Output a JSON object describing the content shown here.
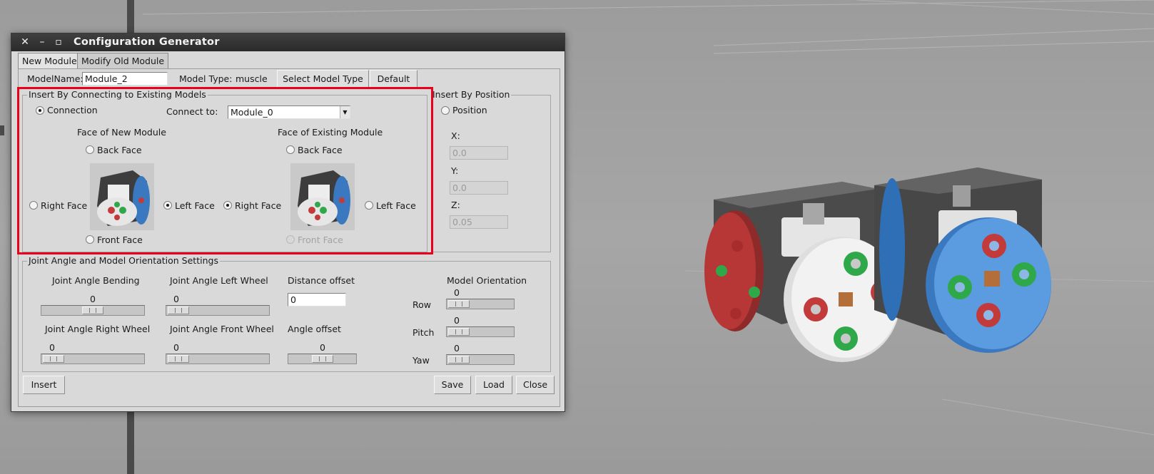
{
  "dialog": {
    "title": "Configuration Generator",
    "window_buttons": {
      "close": "✕",
      "minimize": "–",
      "maximize": "▫"
    },
    "tabs": [
      {
        "label": "New Module",
        "active": true
      },
      {
        "label": "Modify Old Module",
        "active": false
      }
    ],
    "model_name_label": "ModelName:",
    "model_name_value": "Module_2",
    "model_type_label": "Model Type:",
    "model_type_value": "muscle",
    "select_model_type_button": "Select Model Type",
    "default_button": "Default",
    "connect_group": {
      "title": "Insert By Connecting to Existing Models",
      "connection_label": "Connection",
      "connection_checked": true,
      "connect_to_label": "Connect to:",
      "connect_to_value": "Module_0",
      "new_face_title": "Face of New Module",
      "existing_face_title": "Face of Existing Module",
      "new_faces": {
        "back": "Back Face",
        "right": "Right Face",
        "left": "Left Face",
        "front": "Front Face",
        "selected": "left"
      },
      "existing_faces": {
        "back": "Back Face",
        "right": "Right Face",
        "left": "Left Face",
        "front": "Front Face",
        "selected": "right",
        "disabled": "front"
      }
    },
    "position_group": {
      "title": "Insert By Position",
      "position_label": "Position",
      "x_label": "X:",
      "x_value": "0.0",
      "y_label": "Y:",
      "y_value": "0.0",
      "z_label": "Z:",
      "z_value": "0.05"
    },
    "joint_group": {
      "title": "Joint Angle and Model Orientation Settings",
      "bending": {
        "label": "Joint Angle Bending",
        "value": "0",
        "fraction": 0.5
      },
      "left_wheel": {
        "label": "Joint Angle Left Wheel",
        "value": "0",
        "fraction": 0.0
      },
      "right_wheel": {
        "label": "Joint Angle Right Wheel",
        "value": "0",
        "fraction": 0.0
      },
      "front_wheel": {
        "label": "Joint Angle Front Wheel",
        "value": "0",
        "fraction": 0.0
      },
      "distance_offset_label": "Distance offset",
      "distance_offset_value": "0",
      "angle_offset": {
        "label": "Angle offset",
        "value": "0",
        "fraction": 0.5
      },
      "orientation_title": "Model Orientation",
      "row": {
        "label": "Row",
        "value": "0",
        "fraction": 0.0
      },
      "pitch": {
        "label": "Pitch",
        "value": "0",
        "fraction": 0.0
      },
      "yaw": {
        "label": "Yaw",
        "value": "0",
        "fraction": 0.0
      }
    },
    "insert_button": "Insert",
    "save_button": "Save",
    "load_button": "Load",
    "close_button": "Close"
  },
  "colors": {
    "highlight": "#e8001c",
    "face_red": "#c33a3a",
    "face_blue": "#4d8fd6",
    "face_green": "#2fa84a"
  }
}
